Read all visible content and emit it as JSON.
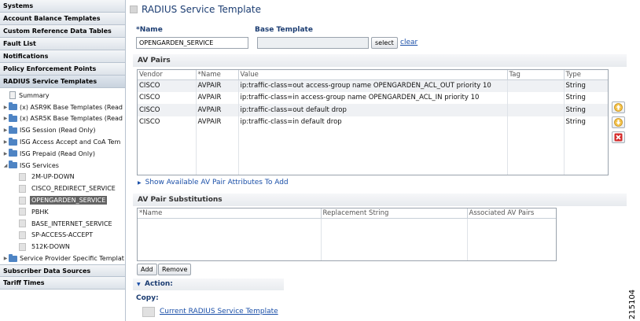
{
  "sidebar": {
    "headers_top": [
      {
        "label": "Systems"
      },
      {
        "label": "Account Balance Templates"
      },
      {
        "label": "Custom Reference Data Tables"
      },
      {
        "label": "Fault List"
      },
      {
        "label": "Notifications"
      },
      {
        "label": "Policy Enforcement Points"
      },
      {
        "label": "RADIUS Service Templates"
      }
    ],
    "tree": {
      "summary": "Summary",
      "folders": [
        {
          "label": "(x) ASR9K Base Templates (Read"
        },
        {
          "label": "(x) ASR5K Base Templates (Read"
        },
        {
          "label": "ISG Session (Read Only)"
        },
        {
          "label": "ISG Access Accept and CoA Tem"
        },
        {
          "label": "ISG Prepaid (Read Only)"
        },
        {
          "label": "ISG Services"
        }
      ],
      "services": [
        {
          "label": "2M-UP-DOWN"
        },
        {
          "label": "CISCO_REDIRECT_SERVICE"
        },
        {
          "label": "OPENGARDEN_SERVICE"
        },
        {
          "label": "PBHK"
        },
        {
          "label": "BASE_INTERNET_SERVICE"
        },
        {
          "label": "SP-ACCESS-ACCEPT"
        },
        {
          "label": "512K-DOWN"
        }
      ],
      "last_folder": "Service Provider Specific Templat"
    },
    "headers_bottom": [
      {
        "label": "Subscriber Data Sources"
      },
      {
        "label": "Tariff Times"
      }
    ]
  },
  "main": {
    "title": "RADIUS Service Template",
    "name_label": "*Name",
    "name_value": "OPENGARDEN_SERVICE",
    "base_label": "Base Template",
    "base_value": "",
    "select_label": "select",
    "clear_label": "clear",
    "av_pairs": {
      "section_title": "AV Pairs",
      "columns": [
        "Vendor",
        "*Name",
        "Value",
        "Tag",
        "Type"
      ],
      "rows": [
        {
          "vendor": "CISCO",
          "name": "AVPAIR",
          "value": "ip:traffic-class=out access-group name OPENGARDEN_ACL_OUT priority 10",
          "tag": "",
          "type": "String"
        },
        {
          "vendor": "CISCO",
          "name": "AVPAIR",
          "value": "ip:traffic-class=in access-group name OPENGARDEN_ACL_IN priority 10",
          "tag": "",
          "type": "String"
        },
        {
          "vendor": "CISCO",
          "name": "AVPAIR",
          "value": "ip:traffic-class=out default drop",
          "tag": "",
          "type": "String"
        },
        {
          "vendor": "CISCO",
          "name": "AVPAIR",
          "value": "ip:traffic-class=in default drop",
          "tag": "",
          "type": "String"
        }
      ],
      "show_available_label": "Show Available AV Pair Attributes To Add"
    },
    "substitutions": {
      "section_title": "AV Pair Substitutions",
      "columns": [
        "*Name",
        "Replacement String",
        "Associated AV Pairs"
      ],
      "add_label": "Add",
      "remove_label": "Remove"
    },
    "action": {
      "label": "Action:",
      "copy_label": "Copy:",
      "copy_link": "Current RADIUS Service Template"
    }
  },
  "watermark": "215104",
  "colors": {
    "title": "#1c3d72",
    "link": "#1a4fa8",
    "selected_bg": "#646464",
    "folder": "#4e84c4",
    "move_arrow": "#e8a317",
    "delete": "#d62b2b"
  }
}
